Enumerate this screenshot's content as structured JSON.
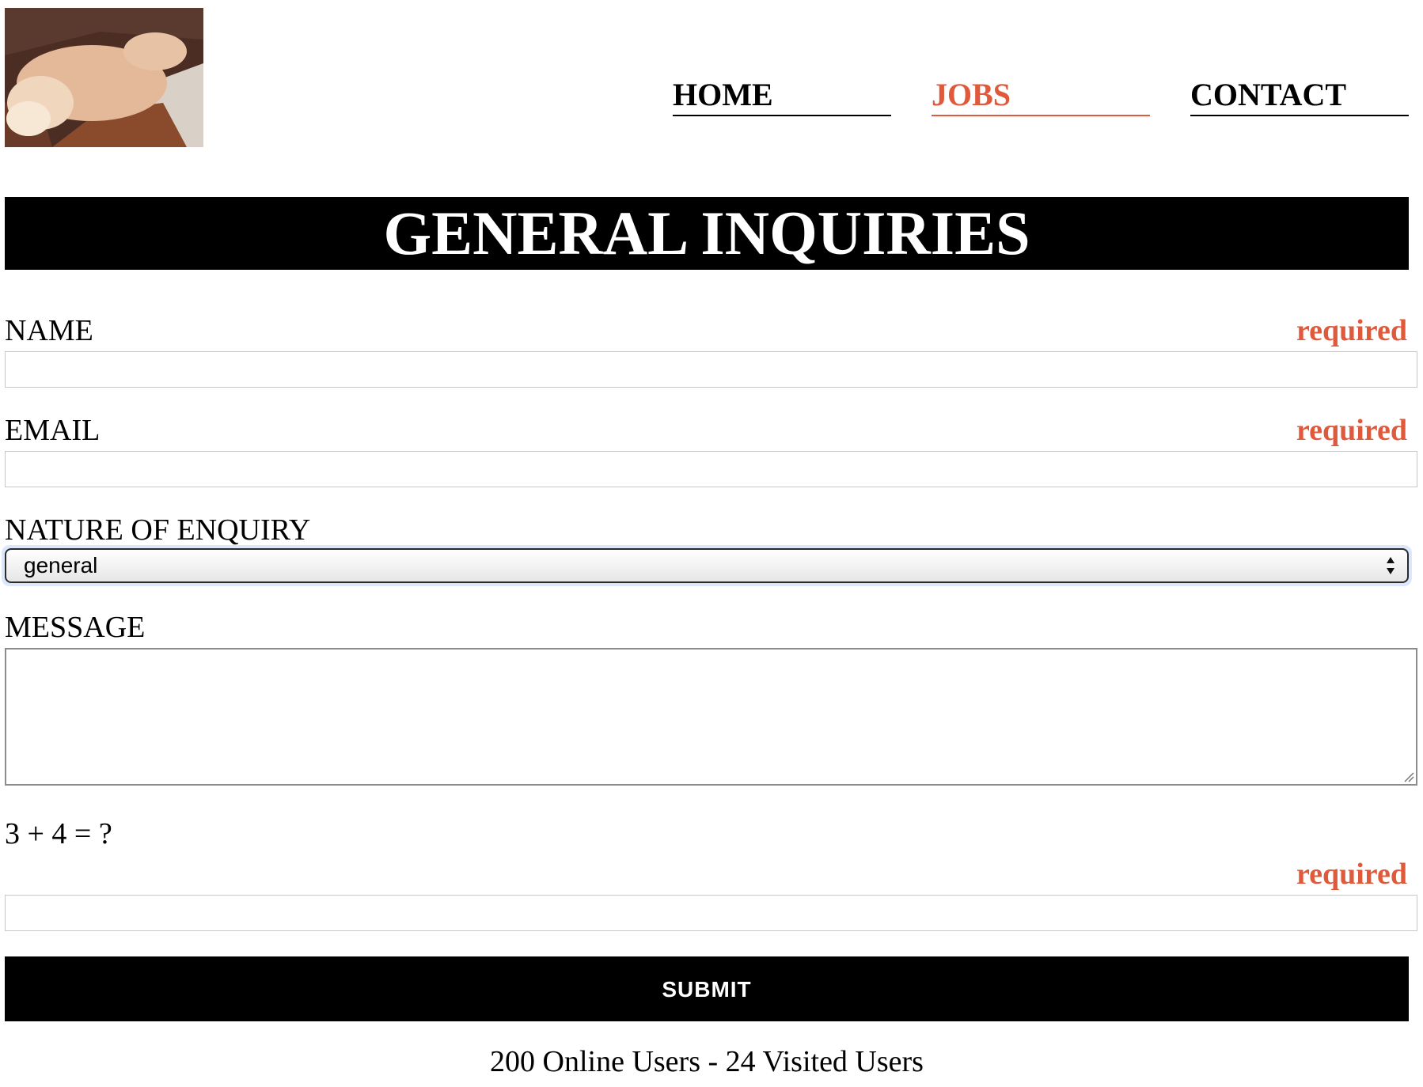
{
  "header": {
    "logo_alt": "dog photo",
    "nav": [
      {
        "label": "HOME",
        "active": false
      },
      {
        "label": "JOBS",
        "active": true
      },
      {
        "label": "CONTACT",
        "active": false
      }
    ]
  },
  "banner": {
    "title": "GENERAL INQUIRIES"
  },
  "form": {
    "name": {
      "label": "NAME",
      "required_text": "required",
      "value": ""
    },
    "email": {
      "label": "EMAIL",
      "required_text": "required",
      "value": ""
    },
    "enquiry": {
      "label": "NATURE OF ENQUIRY",
      "selected": "general"
    },
    "message": {
      "label": "MESSAGE",
      "value": ""
    },
    "captcha": {
      "question": "3 + 4 = ?",
      "required_text": "required",
      "value": ""
    },
    "submit_label": "SUBMIT"
  },
  "footer": {
    "stats": "200 Online Users - 24 Visited Users"
  },
  "colors": {
    "accent": "#e0593a",
    "banner_bg": "#000000",
    "button_bg": "#000000"
  }
}
